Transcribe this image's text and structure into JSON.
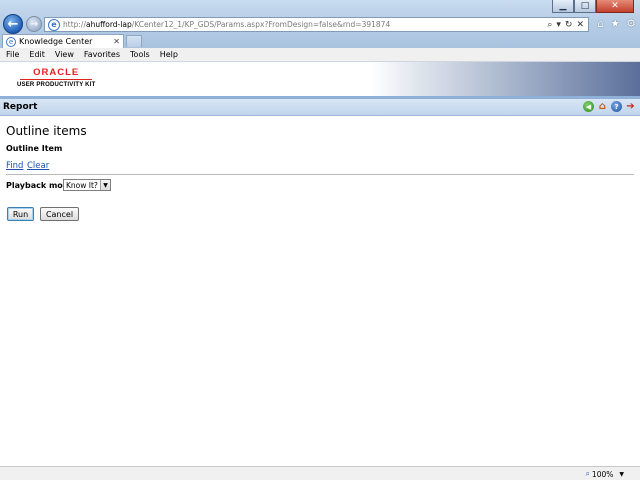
{
  "browser": {
    "window_controls": {
      "minimize": "▁",
      "maximize": "□",
      "close": "✕"
    },
    "back_icon": "←",
    "forward_icon": "→",
    "address": {
      "prefix": "http://",
      "host": "ahufford-lap",
      "path": "/KCenter12_1/KP_GDS/Params.aspx?FromDesign=false&rnd=391874",
      "tools": [
        "⌕",
        "▾",
        "↻",
        "✕"
      ]
    },
    "toolbar_icons": {
      "home": "⌂",
      "favorites": "★",
      "tools": "⚙"
    },
    "tab": {
      "label": "Knowledge Center",
      "close": "✕"
    },
    "menu": [
      "File",
      "Edit",
      "View",
      "Favorites",
      "Tools",
      "Help"
    ],
    "status": {
      "zoom": "100%"
    }
  },
  "logo": {
    "brand": "ORACLE",
    "product": "USER PRODUCTIVITY KIT"
  },
  "report_bar": {
    "title": "Report"
  },
  "page": {
    "title": "Outline items",
    "section": "Outline Item",
    "find_link": "Find",
    "clear_link": "Clear",
    "playback_label": "Playback mode",
    "playback_value": "Know It?",
    "run_button": "Run",
    "cancel_button": "Cancel"
  },
  "colors": {
    "oracle_red": "#e0231c",
    "link_blue": "#1a4fb0",
    "report_bar": "#c1d5ec"
  }
}
